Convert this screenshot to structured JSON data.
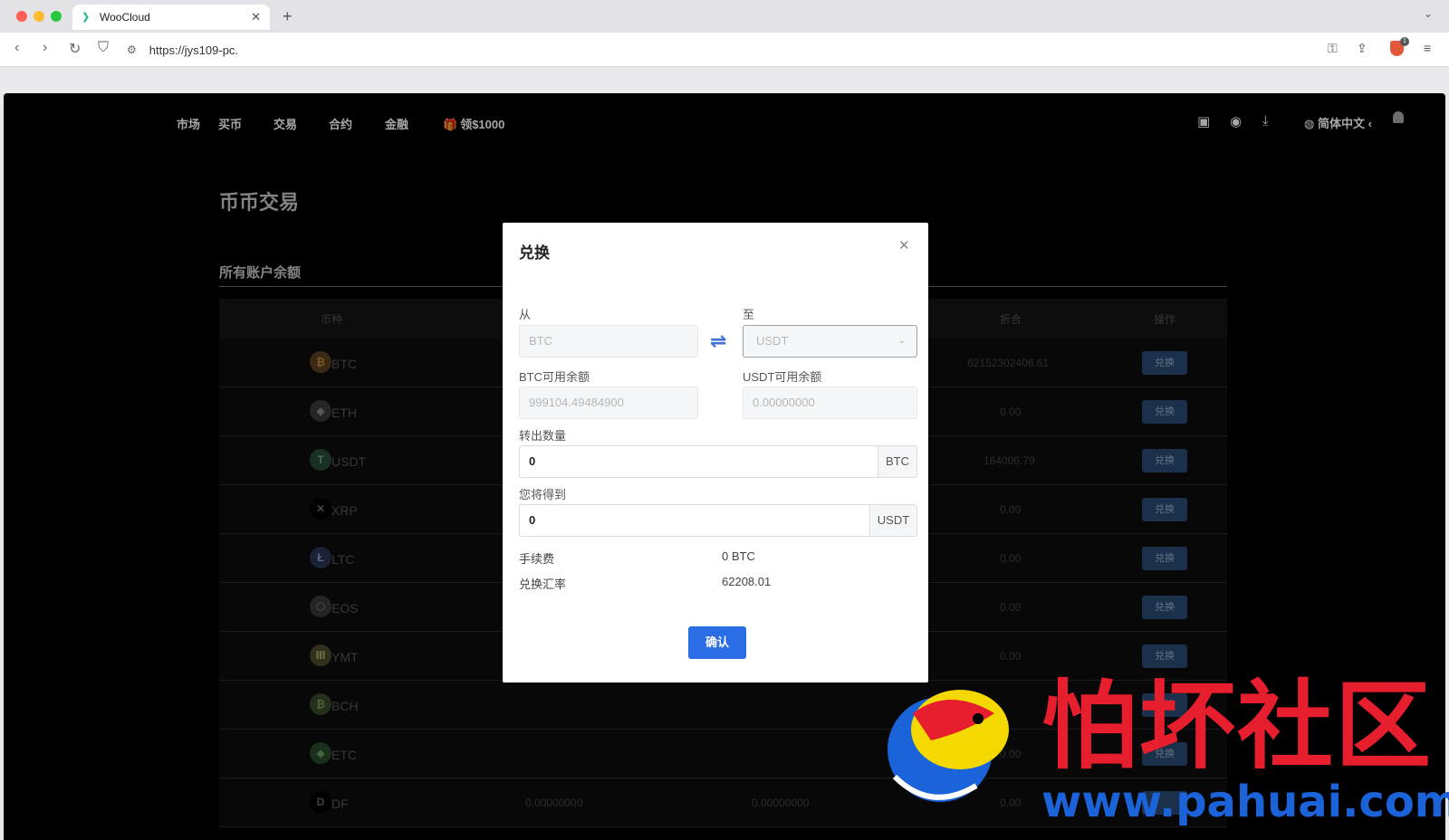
{
  "browser": {
    "tab_title": "WooCloud",
    "url": "https://jys109-pc."
  },
  "nav": {
    "items": [
      "市场",
      "买币",
      "交易",
      "合约",
      "金融"
    ],
    "promo": "领$1000",
    "language": "简体中文"
  },
  "page": {
    "title": "币币交易",
    "section": "所有账户余额"
  },
  "table": {
    "headers": {
      "coin": "币种",
      "convert": "折合",
      "action": "操作"
    },
    "rows": [
      {
        "symbol": "BTC",
        "convert": "62152302406.61",
        "action": "兑换"
      },
      {
        "symbol": "ETH",
        "convert": "0.00",
        "action": "兑换"
      },
      {
        "symbol": "USDT",
        "convert": "164006.79",
        "action": "兑换"
      },
      {
        "symbol": "XRP",
        "convert": "0.00",
        "action": "兑换"
      },
      {
        "symbol": "LTC",
        "convert": "0.00",
        "action": "兑换"
      },
      {
        "symbol": "EOS",
        "convert": "0.00",
        "action": "兑换"
      },
      {
        "symbol": "YMT",
        "convert": "0.00",
        "action": "兑换"
      },
      {
        "symbol": "BCH",
        "convert": "",
        "action": "兑换"
      },
      {
        "symbol": "ETC",
        "convert": "0.00",
        "action": "兑换"
      },
      {
        "symbol": "DF",
        "available": "0.00000000",
        "frozen": "0.00000000",
        "convert": "0.00",
        "action": ""
      }
    ]
  },
  "modal": {
    "title": "兑换",
    "from_label": "从",
    "to_label": "至",
    "from_value": "BTC",
    "to_value": "USDT",
    "from_balance_label": "BTC可用余额",
    "to_balance_label": "USDT可用余额",
    "from_balance": "999104.49484900",
    "to_balance": "0.00000000",
    "amount_label": "转出数量",
    "amount_value": "0",
    "amount_unit": "BTC",
    "receive_label": "您将得到",
    "receive_value": "0",
    "receive_unit": "USDT",
    "fee_label": "手续费",
    "fee_value": "0 BTC",
    "rate_label": "兑换汇率",
    "rate_value": "62208.01",
    "confirm": "确认"
  },
  "watermark": {
    "cn": "怕坏社区",
    "url": "www.pahuai.com"
  },
  "colors": {
    "primary": "#2b6de5",
    "watermark_red": "#e61e2e",
    "watermark_blue": "#1b63d8"
  }
}
